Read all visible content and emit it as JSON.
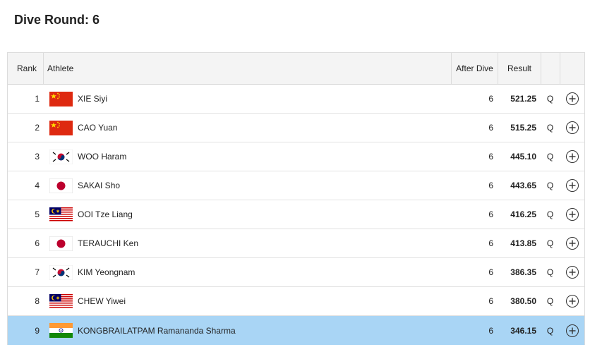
{
  "page": {
    "title": "Dive Round: 6"
  },
  "table": {
    "headers": {
      "rank": "Rank",
      "athlete": "Athlete",
      "after_dive": "After Dive",
      "result": "Result"
    },
    "rows": [
      {
        "rank": "1",
        "athlete": "XIE Siyi",
        "flag": "china-flag-icon",
        "after_dive": "6",
        "result": "521.25",
        "q": "Q"
      },
      {
        "rank": "2",
        "athlete": "CAO Yuan",
        "flag": "china-flag-icon",
        "after_dive": "6",
        "result": "515.25",
        "q": "Q"
      },
      {
        "rank": "3",
        "athlete": "WOO Haram",
        "flag": "korea-flag-icon",
        "after_dive": "6",
        "result": "445.10",
        "q": "Q"
      },
      {
        "rank": "4",
        "athlete": "SAKAI Sho",
        "flag": "japan-flag-icon",
        "after_dive": "6",
        "result": "443.65",
        "q": "Q"
      },
      {
        "rank": "5",
        "athlete": "OOI Tze Liang",
        "flag": "malaysia-flag-icon",
        "after_dive": "6",
        "result": "416.25",
        "q": "Q"
      },
      {
        "rank": "6",
        "athlete": "TERAUCHI Ken",
        "flag": "japan-flag-icon",
        "after_dive": "6",
        "result": "413.85",
        "q": "Q"
      },
      {
        "rank": "7",
        "athlete": "KIM Yeongnam",
        "flag": "korea-flag-icon",
        "after_dive": "6",
        "result": "386.35",
        "q": "Q"
      },
      {
        "rank": "8",
        "athlete": "CHEW Yiwei",
        "flag": "malaysia-flag-icon",
        "after_dive": "6",
        "result": "380.50",
        "q": "Q"
      },
      {
        "rank": "9",
        "athlete": "KONGBRAILATPAM Ramananda Sharma",
        "flag": "india-flag-icon",
        "after_dive": "6",
        "result": "346.15",
        "q": "Q",
        "highlighted": true
      }
    ]
  },
  "colors": {
    "highlight": "#a9d5f5",
    "header_bg": "#f4f4f4"
  }
}
